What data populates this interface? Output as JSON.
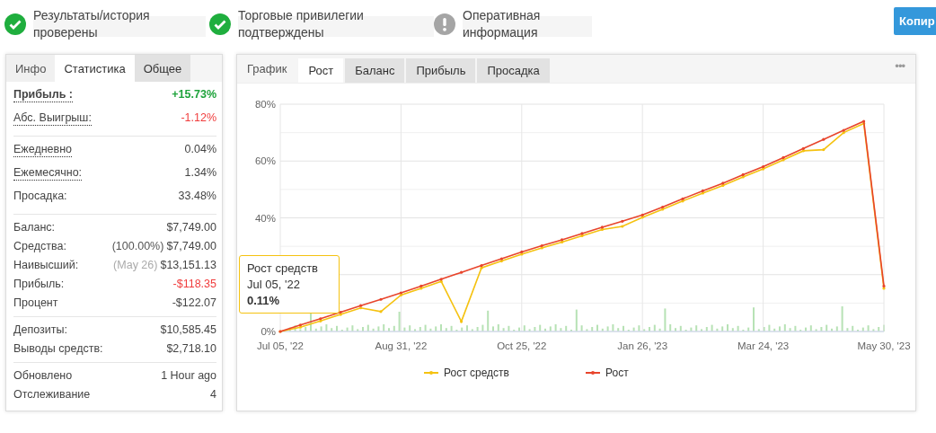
{
  "verifications": [
    {
      "label": "Результаты/история проверены",
      "kind": "verified"
    },
    {
      "label": "Торговые привилегии подтверждены",
      "kind": "verified"
    },
    {
      "label": "Оперативная информация",
      "kind": "info"
    }
  ],
  "copy_button": "Копир",
  "stats": {
    "tabs": [
      {
        "label": "Инфо",
        "selected": false
      },
      {
        "label": "Статистика",
        "selected": true
      },
      {
        "label": "Общее",
        "selected": false
      }
    ],
    "groups": [
      [
        {
          "label": "Прибыль :",
          "value": "+15.73%",
          "color": "#1fa33c",
          "dotted": true,
          "emphasis": true
        },
        {
          "label": "Абс. Выигрыш:",
          "value": "-1.12%",
          "color": "#f03c3c",
          "dotted": true,
          "emphasis": false
        }
      ],
      [
        {
          "label": "Ежедневно",
          "value": "0.04%",
          "color": "#444444",
          "dotted": true,
          "emphasis": false
        },
        {
          "label": "Ежемесячно:",
          "value": "1.34%",
          "color": "#444444",
          "dotted": true,
          "emphasis": false
        },
        {
          "label": "Просадка:",
          "value": "33.48%",
          "color": "#444444",
          "dotted": false,
          "emphasis": false
        }
      ],
      [
        {
          "label": "Баланс:",
          "value": "$7,749.00",
          "color": "#444444",
          "dotted": false,
          "emphasis": false
        },
        {
          "label": "Средства:",
          "note": "(100.00%)",
          "value": "$7,749.00",
          "color": "#444444",
          "dotted": false,
          "emphasis": false
        },
        {
          "label": "Наивысший:",
          "note": "(May 26)",
          "value": "$13,151.13",
          "color": "#444444",
          "dotted": false,
          "emphasis": false
        },
        {
          "label": "Прибыль:",
          "value": "-$118.35",
          "color": "#f03c3c",
          "dotted": false,
          "emphasis": false
        },
        {
          "label": "Процент",
          "value": "-$122.07",
          "color": "#444444",
          "dotted": false,
          "emphasis": false
        }
      ],
      [
        {
          "label": "Депозиты:",
          "value": "$10,585.45",
          "color": "#444444",
          "dotted": false,
          "emphasis": false
        },
        {
          "label": "Выводы средств:",
          "value": "$2,718.10",
          "color": "#444444",
          "dotted": false,
          "emphasis": false
        }
      ],
      [
        {
          "label": "Обновлено",
          "value": "1 Hour ago",
          "color": "#444444",
          "dotted": false,
          "emphasis": false
        },
        {
          "label": "Отслеживание",
          "value": "4",
          "color": "#444444",
          "dotted": false,
          "emphasis": false
        }
      ]
    ]
  },
  "chart_panel": {
    "tabs": [
      {
        "label": "График",
        "selected": false
      },
      {
        "label": "Рост",
        "selected": true
      },
      {
        "label": "Баланс",
        "selected": false
      },
      {
        "label": "Прибыль",
        "selected": false
      },
      {
        "label": "Просадка",
        "selected": false
      }
    ],
    "more": "•••",
    "tooltip": {
      "title": "Рост средств",
      "date": "Jul 05, '22",
      "value": "0.11%"
    },
    "chart_data": {
      "type": "line",
      "categories": [
        "Jul 05, '22",
        null,
        null,
        null,
        null,
        null,
        "Aug 31, '22",
        null,
        null,
        null,
        null,
        null,
        "Oct 25, '22",
        null,
        null,
        null,
        null,
        null,
        "Jan 26, '23",
        null,
        null,
        null,
        null,
        null,
        "Mar 24, '23",
        null,
        null,
        null,
        null,
        null,
        "May 30, '23"
      ],
      "ylim": [
        0,
        80
      ],
      "yticks": [
        {
          "value": 0,
          "label": "0%"
        },
        {
          "value": 40,
          "label": "40%"
        },
        {
          "value": 60,
          "label": "60%"
        },
        {
          "value": 80,
          "label": "80%"
        }
      ],
      "grid": true,
      "legend": true,
      "series": [
        {
          "name": "Рост средств",
          "color": "#f5c211",
          "values": [
            0,
            1.5,
            3.7,
            6,
            8.3,
            7,
            12.8,
            15.2,
            17.6,
            3.5,
            22.4,
            24.8,
            27.2,
            29.4,
            31.5,
            33.7,
            35.9,
            37,
            40.2,
            43,
            45.9,
            48.7,
            51.4,
            54.4,
            57.2,
            60.4,
            63.6,
            64,
            70,
            73.2,
            15.2
          ]
        },
        {
          "name": "Рост",
          "color": "#e8452c",
          "values": [
            0,
            2.3,
            4.5,
            6.8,
            9.1,
            11.3,
            13.6,
            16,
            18.4,
            20.8,
            23.2,
            25.6,
            28,
            30.2,
            32.3,
            34.5,
            36.7,
            38.8,
            41,
            43.8,
            46.7,
            49.5,
            52.2,
            55.2,
            58,
            61.2,
            64.4,
            67.6,
            70.8,
            74,
            16
          ]
        }
      ]
    }
  }
}
